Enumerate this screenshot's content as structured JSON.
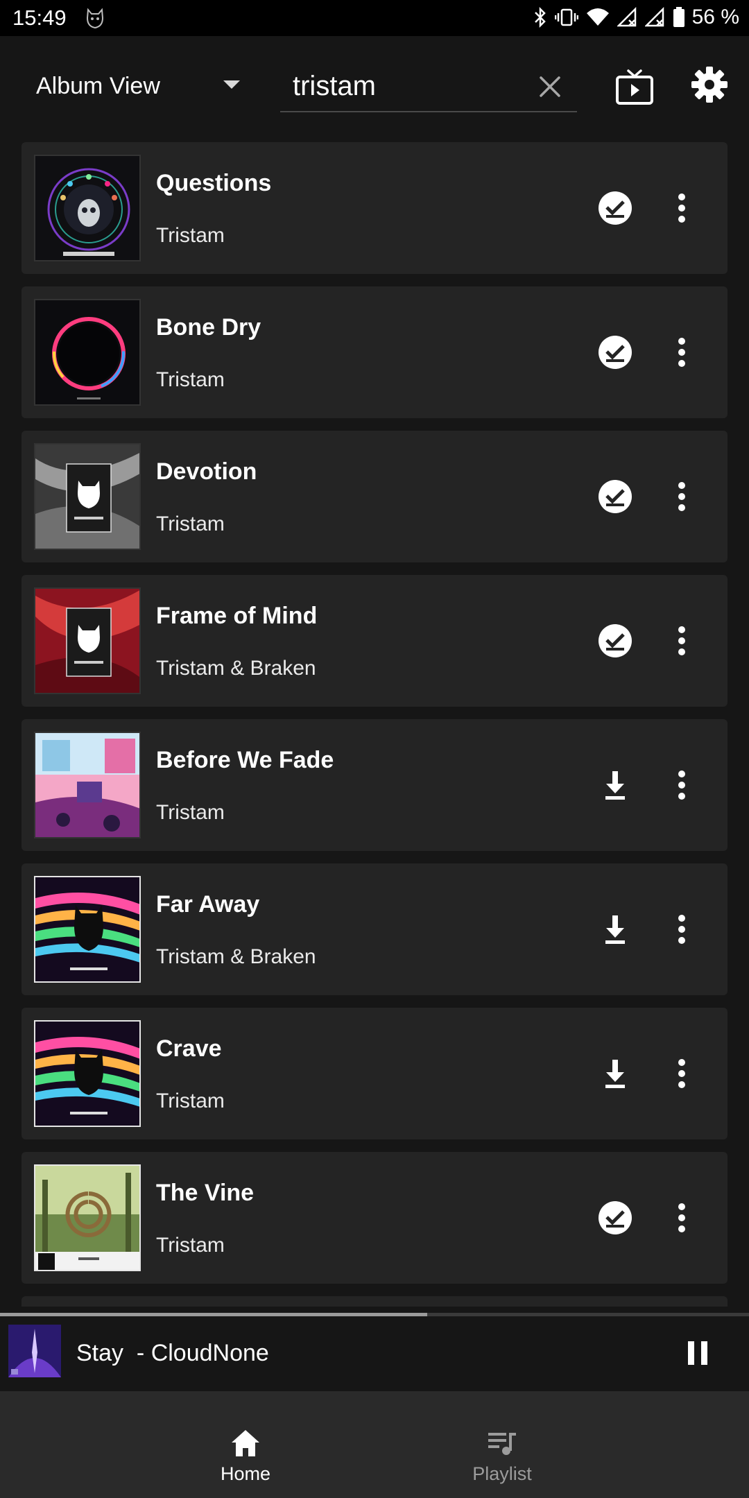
{
  "status_bar": {
    "time": "15:49",
    "battery": "56 %"
  },
  "header": {
    "view_mode": "Album View",
    "search_value": "tristam"
  },
  "tracks": [
    {
      "title": "Questions",
      "artist": "Tristam",
      "state": "downloaded"
    },
    {
      "title": "Bone Dry",
      "artist": "Tristam",
      "state": "downloaded"
    },
    {
      "title": "Devotion",
      "artist": "Tristam",
      "state": "downloaded"
    },
    {
      "title": "Frame of Mind",
      "artist": "Tristam & Braken",
      "state": "downloaded"
    },
    {
      "title": "Before We Fade",
      "artist": "Tristam",
      "state": "download"
    },
    {
      "title": "Far Away",
      "artist": "Tristam & Braken",
      "state": "download"
    },
    {
      "title": "Crave",
      "artist": "Tristam",
      "state": "download"
    },
    {
      "title": "The Vine",
      "artist": "Tristam",
      "state": "downloaded"
    }
  ],
  "player": {
    "now_playing": "Stay  - CloudNone",
    "progress": 0.57
  },
  "nav": {
    "home_label": "Home",
    "playlist_label": "Playlist"
  },
  "colors": {
    "background": "#161616",
    "card": "#242424",
    "nav_background": "#2a2a2a",
    "active_nav": "#ffffff",
    "inactive_nav": "#9c9c9c"
  },
  "icons": [
    "wifi-icon",
    "bluetooth-icon",
    "vibrate-icon",
    "cast-icon",
    "settings-icon",
    "check-circle-icon",
    "download-icon",
    "more-vert-icon",
    "pause-icon",
    "home-icon",
    "playlist-icon"
  ]
}
